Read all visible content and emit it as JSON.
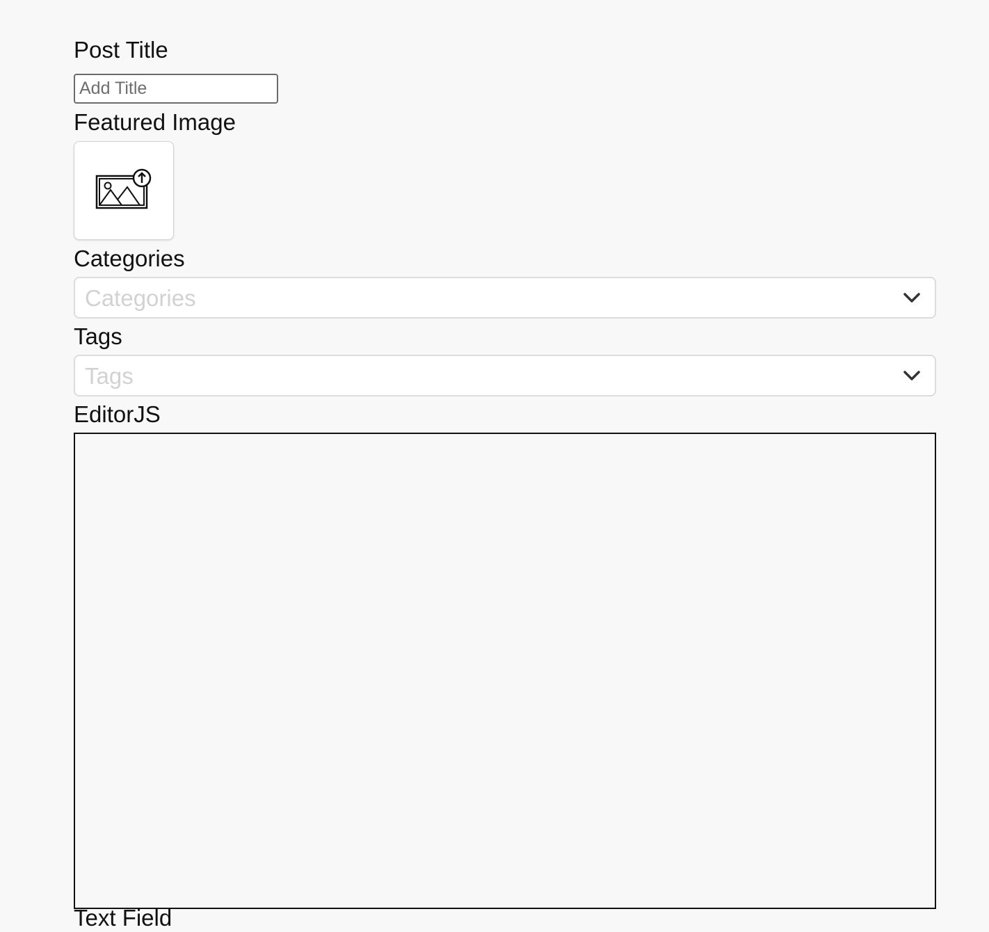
{
  "form": {
    "post_title": {
      "label": "Post Title",
      "placeholder": "Add Title",
      "value": ""
    },
    "featured_image": {
      "label": "Featured Image",
      "icon": "image-upload-icon"
    },
    "categories": {
      "label": "Categories",
      "placeholder": "Categories",
      "icon": "chevron-down-icon"
    },
    "tags": {
      "label": "Tags",
      "placeholder": "Tags",
      "icon": "chevron-down-icon"
    },
    "editor": {
      "label": "EditorJS"
    },
    "next_field": {
      "label": "Text Field"
    }
  },
  "colors": {
    "background": "#f8f8f8",
    "input_border": "#6b6b6b",
    "select_border": "#dcdcdc",
    "placeholder": "#d2d2d2",
    "editor_border": "#111111"
  }
}
